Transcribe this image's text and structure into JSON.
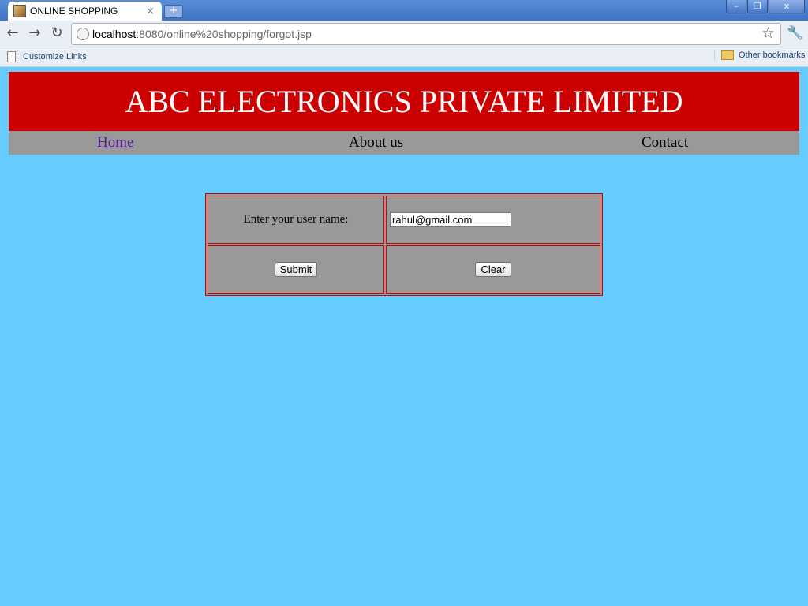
{
  "browser": {
    "tab_title": "ONLINE SHOPPING",
    "tab_close": "×",
    "new_tab": "+",
    "window_minimize": "–",
    "window_restore": "❐",
    "window_close": "x",
    "url_host": "localhost",
    "url_rest": ":8080/online%20shopping/forgot.jsp",
    "bookmark_left": "Customize Links",
    "bookmark_right": "Other bookmarks"
  },
  "page": {
    "banner_title": "ABC ELECTRONICS PRIVATE LIMITED",
    "nav": {
      "home": "Home",
      "about": "About us",
      "contact": "Contact"
    },
    "form": {
      "username_label": "Enter your user name:",
      "username_value": "rahul@gmail.com",
      "submit_label": "Submit",
      "clear_label": "Clear"
    }
  },
  "colors": {
    "page_bg": "#66ccff",
    "banner_bg": "#cc0000",
    "nav_bg": "#999999",
    "table_border": "#cc0000"
  }
}
